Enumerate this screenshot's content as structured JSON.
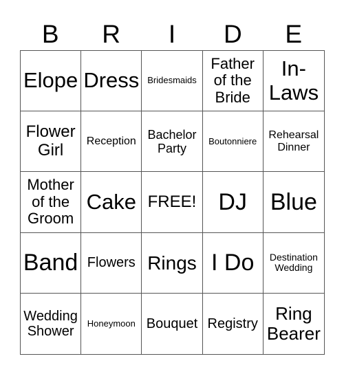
{
  "title_letters": [
    "B",
    "R",
    "I",
    "D",
    "E"
  ],
  "cells": [
    [
      "Elope",
      "Dress",
      "Bridesmaids",
      "Father of the Bride",
      "In-Laws"
    ],
    [
      "Flower Girl",
      "Reception",
      "Bachelor Party",
      "Boutonniere",
      "Rehearsal Dinner"
    ],
    [
      "Mother of the Groom",
      "Cake",
      "FREE!",
      "DJ",
      "Blue"
    ],
    [
      "Band",
      "Flowers",
      "Rings",
      "I Do",
      "Destination Wedding"
    ],
    [
      "Wedding Shower",
      "Honeymoon",
      "Bouquet",
      "Registry",
      "Ring Bearer"
    ]
  ]
}
